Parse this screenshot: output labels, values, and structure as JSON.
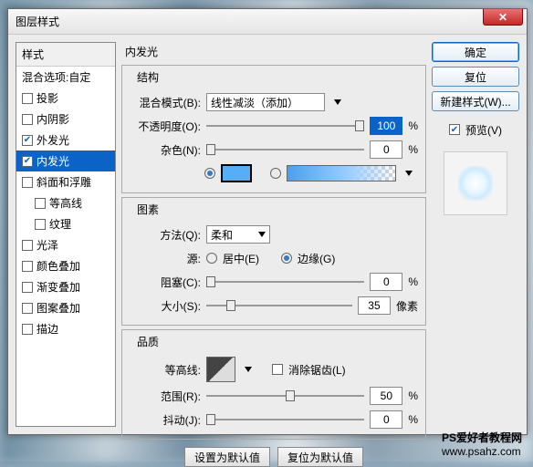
{
  "window": {
    "title": "图层样式"
  },
  "sidebar": {
    "header": "样式",
    "blending": "混合选项:自定",
    "items": [
      {
        "label": "投影",
        "checked": false
      },
      {
        "label": "内阴影",
        "checked": false
      },
      {
        "label": "外发光",
        "checked": true
      },
      {
        "label": "内发光",
        "checked": true,
        "selected": true
      },
      {
        "label": "斜面和浮雕",
        "checked": false
      },
      {
        "label": "等高线",
        "sub": true,
        "checked": false
      },
      {
        "label": "纹理",
        "sub": true,
        "checked": false
      },
      {
        "label": "光泽",
        "checked": false
      },
      {
        "label": "颜色叠加",
        "checked": false
      },
      {
        "label": "渐变叠加",
        "checked": false
      },
      {
        "label": "图案叠加",
        "checked": false
      },
      {
        "label": "描边",
        "checked": false
      }
    ]
  },
  "panel_title": "内发光",
  "structure": {
    "title": "结构",
    "blend_mode_label": "混合模式(B):",
    "blend_mode_value": "线性减淡（添加）",
    "opacity_label": "不透明度(O):",
    "opacity_value": "100",
    "opacity_unit": "%",
    "noise_label": "杂色(N):",
    "noise_value": "0",
    "noise_unit": "%",
    "color_selected": true
  },
  "elements": {
    "title": "图素",
    "method_label": "方法(Q):",
    "method_value": "柔和",
    "source_label": "源:",
    "source_center": "居中(E)",
    "source_edge": "边缘(G)",
    "choke_label": "阻塞(C):",
    "choke_value": "0",
    "choke_unit": "%",
    "size_label": "大小(S):",
    "size_value": "35",
    "size_unit": "像素"
  },
  "quality": {
    "title": "品质",
    "contour_label": "等高线:",
    "antialias_label": "消除锯齿(L)",
    "range_label": "范围(R):",
    "range_value": "50",
    "range_unit": "%",
    "jitter_label": "抖动(J):",
    "jitter_value": "0",
    "jitter_unit": "%"
  },
  "bottom_buttons": {
    "make_default": "设置为默认值",
    "reset_default": "复位为默认值"
  },
  "right": {
    "ok": "确定",
    "cancel": "复位",
    "new_style": "新建样式(W)...",
    "preview_label": "预览(V)"
  },
  "watermark": {
    "line1": "PS爱好者教程网",
    "line2": "www.psahz.com"
  }
}
